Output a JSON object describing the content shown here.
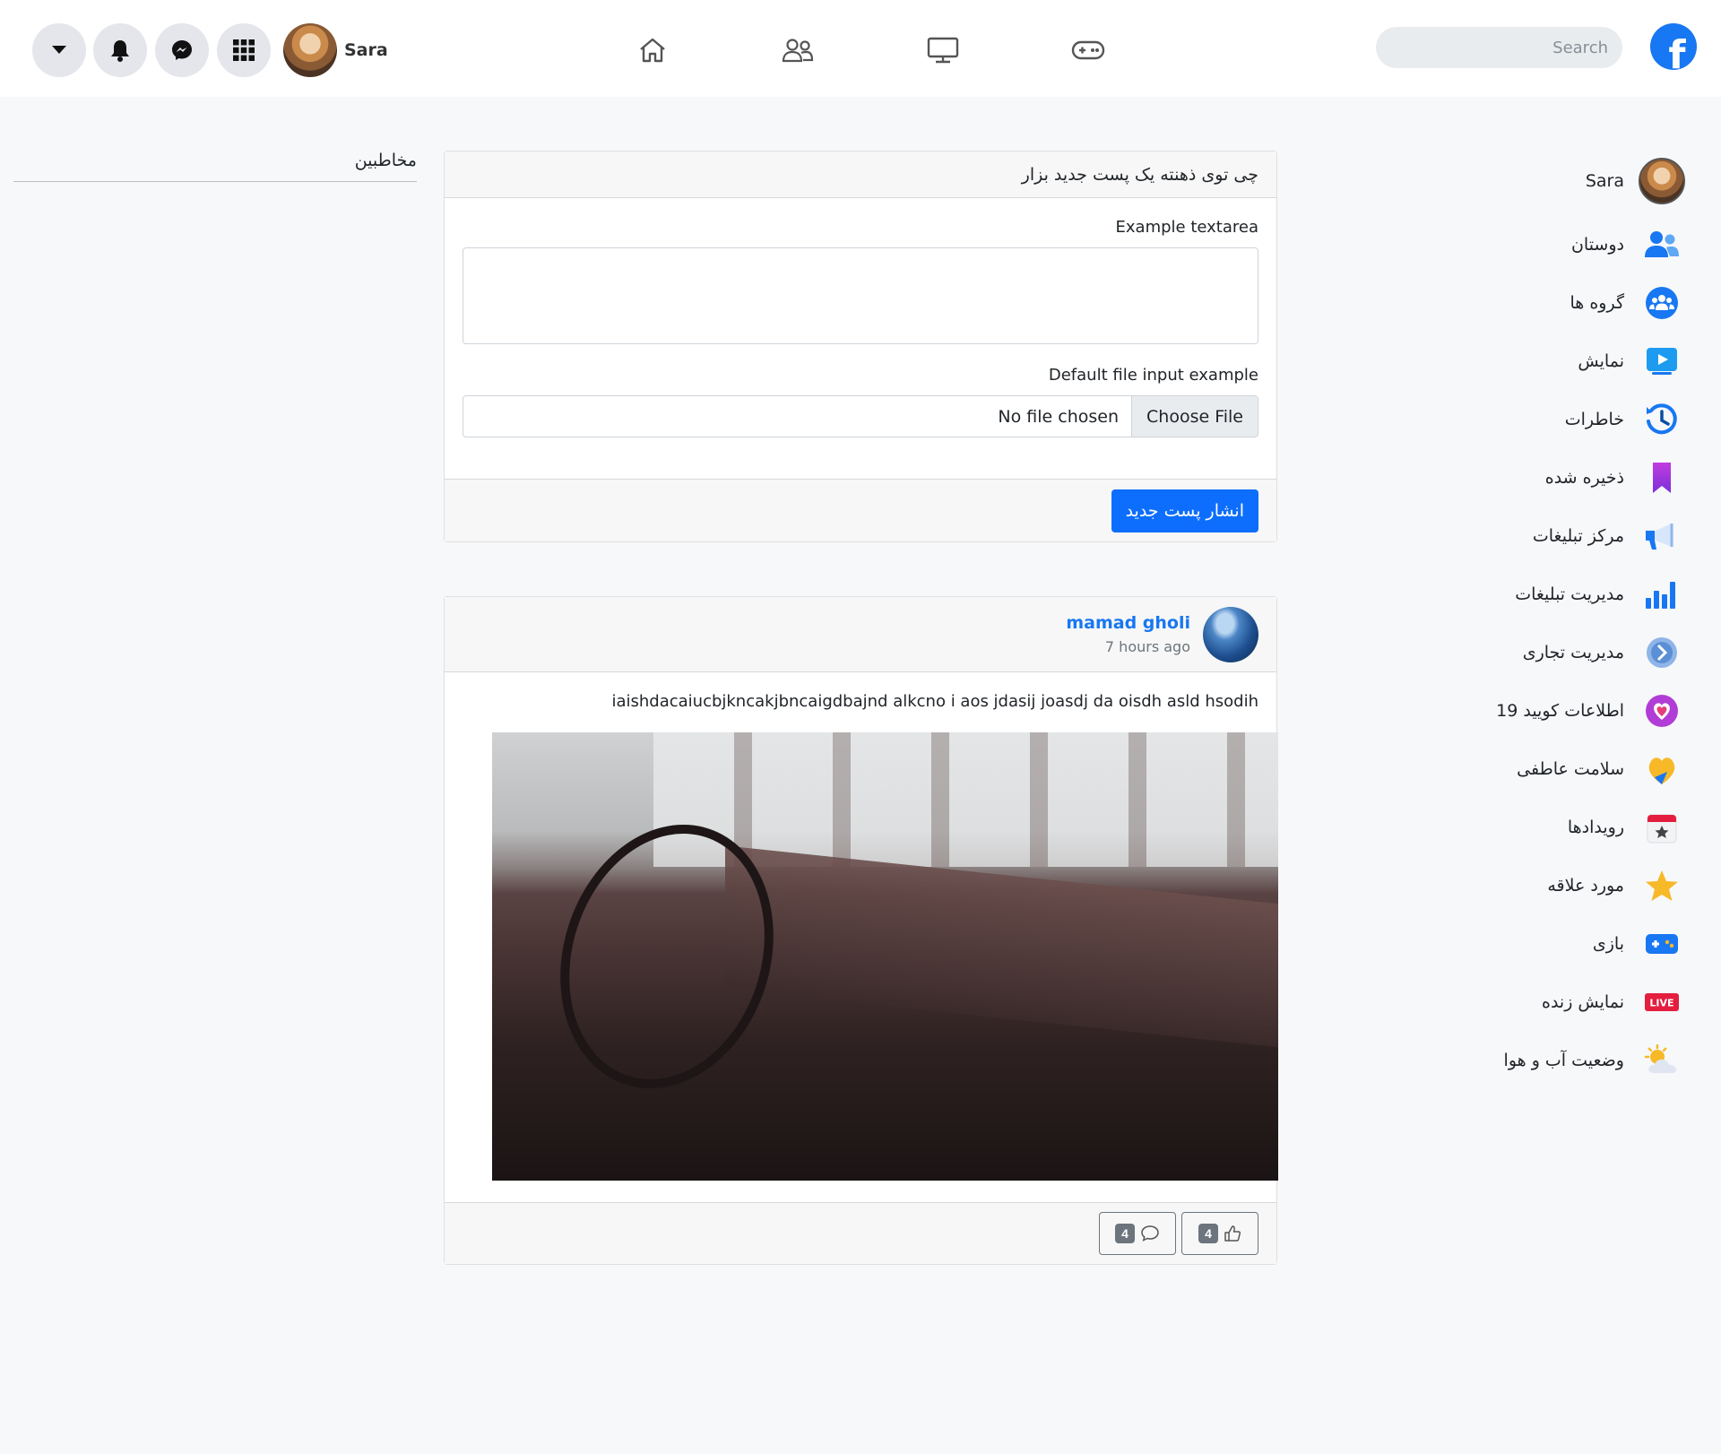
{
  "topbar": {
    "user_name": "Sara",
    "search_placeholder": "Search",
    "logo_letter": "f"
  },
  "contacts": {
    "title": "مخاطبین"
  },
  "post_form": {
    "header": "چی توی ذهنته یک پست جدید بزار",
    "textarea_label": "Example textarea",
    "textarea_value": "",
    "file_label": "Default file input example",
    "file_button": "Choose File",
    "file_status": "No file chosen",
    "publish_label": "انشار پست جدید"
  },
  "post": {
    "author": "mamad gholi",
    "time": "7 hours ago",
    "text": "iaishdacaiucbjkncakjbncaigdbajnd alkcno i aos jdasij joasdj da oisdh asld hsodih",
    "comment_count": "4",
    "like_count": "4"
  },
  "sidebar": {
    "items": [
      {
        "label": "Sara",
        "icon": "user-avatar"
      },
      {
        "label": "دوستان",
        "icon": "friends-icon"
      },
      {
        "label": "گروه ها",
        "icon": "groups-icon"
      },
      {
        "label": "نمایش",
        "icon": "watch-icon"
      },
      {
        "label": "خاطرات",
        "icon": "memories-icon"
      },
      {
        "label": "ذخیره شده",
        "icon": "saved-icon"
      },
      {
        "label": "مرکز تبلیغات",
        "icon": "ad-center-icon"
      },
      {
        "label": "مدیریت تبلیغات",
        "icon": "ads-manager-icon"
      },
      {
        "label": "مدیریت تجاری",
        "icon": "business-manager-icon"
      },
      {
        "label": "اطلاعات کویید 19",
        "icon": "covid-info-icon"
      },
      {
        "label": "سلامت عاطفی",
        "icon": "emotional-health-icon"
      },
      {
        "label": "رویدادها",
        "icon": "events-icon"
      },
      {
        "label": "مورد علاقه",
        "icon": "favorites-icon"
      },
      {
        "label": "بازی",
        "icon": "gaming-icon"
      },
      {
        "label": "نمایش زنده",
        "icon": "live-icon"
      },
      {
        "label": "وضعیت آب و هوا",
        "icon": "weather-icon"
      }
    ],
    "live_badge": "LIVE"
  },
  "colors": {
    "brand": "#1877f2",
    "primary_button": "#0d6efd",
    "secondary": "#6c757d"
  }
}
